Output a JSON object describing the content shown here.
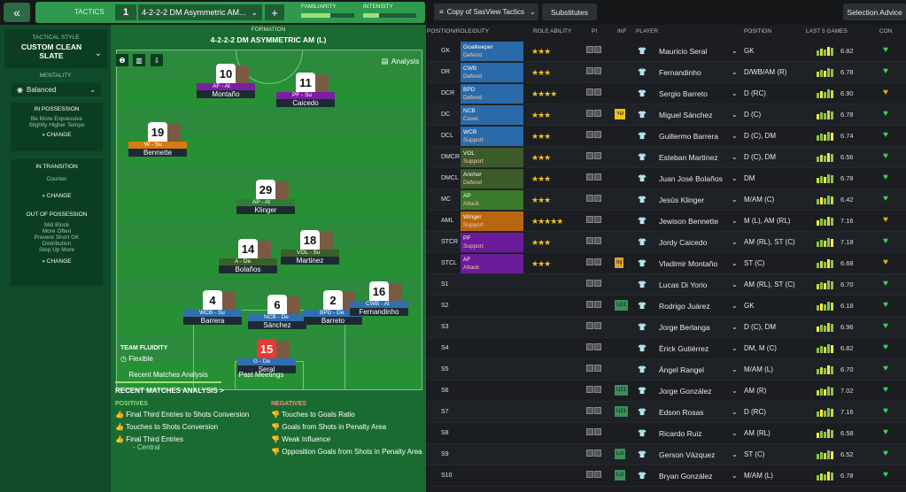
{
  "topbar": {
    "tactics_label": "TACTICS",
    "tactic_slot": "1",
    "tactic_name": "4-2-2-2 DM Asymmetric AM...",
    "familiarity": "FAMILIARITY",
    "intensity": "INTENSITY",
    "view_select": "Copy of SasView Tactics",
    "substitutes": "Substitutes",
    "selection_advice": "Selection Advice"
  },
  "left": {
    "style_label": "TACTICAL STYLE",
    "style_name": "CUSTOM CLEAN SLATE",
    "mentality_label": "MENTALITY",
    "mentality": "Balanced",
    "in_possession": "IN POSSESSION",
    "pos_notes": [
      "Be More Expressive",
      "Slightly Higher Tempo"
    ],
    "in_transition": "IN TRANSITION",
    "trans_notes": [
      "Counter"
    ],
    "out_possession": "OUT OF POSSESSION",
    "out_notes": [
      "Mid Block",
      "More Often",
      "Prevent Short GK Distribution",
      "Step Up More"
    ],
    "change": "CHANGE"
  },
  "pitch": {
    "formation_label": "FORMATION",
    "formation": "4-2-2-2 DM ASYMMETRIC AM (L)",
    "analysis": "Analysis",
    "fluidity_label": "TEAM FLUIDITY",
    "fluidity": "Flexible",
    "cards": [
      {
        "num": "10",
        "role": "AF - At",
        "name": "Montaño",
        "color": "#7b1fa2"
      },
      {
        "num": "11",
        "role": "PF - Su",
        "name": "Caicedo",
        "color": "#7b1fa2"
      },
      {
        "num": "19",
        "role": "W - Su",
        "name": "Bennette",
        "color": "#d87a12"
      },
      {
        "num": "29",
        "role": "AP - At",
        "name": "Klinger",
        "color": "#2e7d32"
      },
      {
        "num": "14",
        "role": "A - De",
        "name": "Bolaños",
        "color": "#3b5f2b"
      },
      {
        "num": "18",
        "role": "VOL - Su",
        "name": "Martinez",
        "color": "#3b5f2b"
      },
      {
        "num": "4",
        "role": "WCB - Su",
        "name": "Barrera",
        "color": "#2f6fb0"
      },
      {
        "num": "6",
        "role": "NCB - De",
        "name": "Sánchez",
        "color": "#2f6fb0"
      },
      {
        "num": "2",
        "role": "BPD - De",
        "name": "Barreto",
        "color": "#2f6fb0"
      },
      {
        "num": "16",
        "role": "CWB - At",
        "name": "Fernandinho",
        "color": "#2f6fb0"
      },
      {
        "num": "15",
        "role": "G - De",
        "name": "Seral",
        "color": "#2f6fb0"
      }
    ]
  },
  "analysis": {
    "tab1": "Recent Matches Analysis",
    "tab2": "Past Meetings",
    "heading": "RECENT MATCHES ANALYSIS >",
    "pos_label": "POSITIVES",
    "neg_label": "NEGATIVES",
    "positives": [
      "Final Third Entries to Shots Conversion",
      "Touches to Shots Conversion",
      "Final Third Entries"
    ],
    "pos_sub": "- Central",
    "negatives": [
      "Touches to Goals Ratio",
      "Goals from Shots in Penalty Area",
      "Weak Influence",
      "Opposition Goals from Shots in Penalty Area"
    ]
  },
  "table": {
    "headers": [
      "POSITION/ROLE/DUTY",
      "ROLE ABILITY",
      "PI",
      "INF",
      "PLAYER",
      "POSITION",
      "LAST 5 GAMES",
      "CON"
    ],
    "rows": [
      {
        "pos": "GK",
        "role": "Goalkeeper",
        "duty": "Defend",
        "rc": "#2b6aa8",
        "stars": "★★★",
        "player": "Mauricio Seral",
        "position": "GK",
        "rating": "6.82",
        "inf": ""
      },
      {
        "pos": "DR",
        "role": "CWB",
        "duty": "Defend",
        "rc": "#2b6aa8",
        "stars": "★★★",
        "player": "Fernandinho",
        "position": "D/WB/AM (R)",
        "rating": "6.78",
        "inf": ""
      },
      {
        "pos": "DCR",
        "role": "BPD",
        "duty": "Defend",
        "rc": "#2b6aa8",
        "stars": "★★★★",
        "player": "Sergio Barreto",
        "position": "D (RC)",
        "rating": "6.90",
        "inf": ""
      },
      {
        "pos": "DC",
        "role": "NCB",
        "duty": "Cover",
        "rc": "#2b6aa8",
        "stars": "★★★",
        "player": "Miguel Sánchez",
        "position": "D (C)",
        "rating": "6.78",
        "inf": "Yel"
      },
      {
        "pos": "DCL",
        "role": "WCB",
        "duty": "Support",
        "rc": "#2b6aa8",
        "stars": "★★★",
        "player": "Guillermo Barrera",
        "position": "D (C), DM",
        "rating": "6.74",
        "inf": ""
      },
      {
        "pos": "DMCR",
        "role": "VOL",
        "duty": "Support",
        "rc": "#3d5a2a",
        "stars": "★★★",
        "player": "Esteban Martínez",
        "position": "D (C), DM",
        "rating": "6.56",
        "inf": ""
      },
      {
        "pos": "DMCL",
        "role": "Anchor",
        "duty": "Defend",
        "rc": "#3d5a2a",
        "stars": "★★★",
        "player": "Juan José Bolaños",
        "position": "DM",
        "rating": "6.78",
        "inf": ""
      },
      {
        "pos": "MC",
        "role": "AP",
        "duty": "Attack",
        "rc": "#3a7a2a",
        "stars": "★★★",
        "player": "Jesús Klinger",
        "position": "M/AM (C)",
        "rating": "6.42",
        "inf": ""
      },
      {
        "pos": "AML",
        "role": "Winger",
        "duty": "Support",
        "rc": "#b8670f",
        "stars": "★★★★★",
        "player": "Jewison Bennette",
        "position": "M (L), AM (RL)",
        "rating": "7.16",
        "inf": ""
      },
      {
        "pos": "STCR",
        "role": "PF",
        "duty": "Support",
        "rc": "#6a1b9a",
        "stars": "★★★",
        "player": "Jordy Caicedo",
        "position": "AM (RL), ST (C)",
        "rating": "7.18",
        "inf": ""
      },
      {
        "pos": "STCL",
        "role": "AF",
        "duty": "Attack",
        "rc": "#6a1b9a",
        "stars": "★★★",
        "player": "Vladimir Montaño",
        "position": "ST (C)",
        "rating": "6.68",
        "inf": "Inj"
      },
      {
        "pos": "S1",
        "role": "",
        "duty": "",
        "rc": "",
        "stars": "",
        "player": "Lucas Di Yorio",
        "position": "AM (RL), ST (C)",
        "rating": "6.70",
        "inf": ""
      },
      {
        "pos": "S2",
        "role": "",
        "duty": "",
        "rc": "",
        "stars": "",
        "player": "Rodrigo Juárez",
        "position": "GK",
        "rating": "6.18",
        "inf": "U21"
      },
      {
        "pos": "S3",
        "role": "",
        "duty": "",
        "rc": "",
        "stars": "",
        "player": "Jorge Berlanga",
        "position": "D (C), DM",
        "rating": "6.96",
        "inf": ""
      },
      {
        "pos": "S4",
        "role": "",
        "duty": "",
        "rc": "",
        "stars": "",
        "player": "Érick Gutiérrez",
        "position": "DM, M (C)",
        "rating": "6.82",
        "inf": ""
      },
      {
        "pos": "S5",
        "role": "",
        "duty": "",
        "rc": "",
        "stars": "",
        "player": "Ángel Rangel",
        "position": "M/AM (L)",
        "rating": "6.70",
        "inf": ""
      },
      {
        "pos": "S6",
        "role": "",
        "duty": "",
        "rc": "",
        "stars": "",
        "player": "Jorge González",
        "position": "AM (R)",
        "rating": "7.02",
        "inf": "U21"
      },
      {
        "pos": "S7",
        "role": "",
        "duty": "",
        "rc": "",
        "stars": "",
        "player": "Edson Rosas",
        "position": "D (RC)",
        "rating": "7.16",
        "inf": "U21"
      },
      {
        "pos": "S8",
        "role": "",
        "duty": "",
        "rc": "",
        "stars": "",
        "player": "Ricardo Ruiz",
        "position": "AM (RL)",
        "rating": "6.58",
        "inf": ""
      },
      {
        "pos": "S9",
        "role": "",
        "duty": "",
        "rc": "",
        "stars": "",
        "player": "Gerson Vázquez",
        "position": "ST (C)",
        "rating": "6.52",
        "inf": "Lst"
      },
      {
        "pos": "S10",
        "role": "",
        "duty": "",
        "rc": "",
        "stars": "",
        "player": "Bryan González",
        "position": "M/AM (L)",
        "rating": "6.78",
        "inf": "Lst"
      }
    ]
  }
}
